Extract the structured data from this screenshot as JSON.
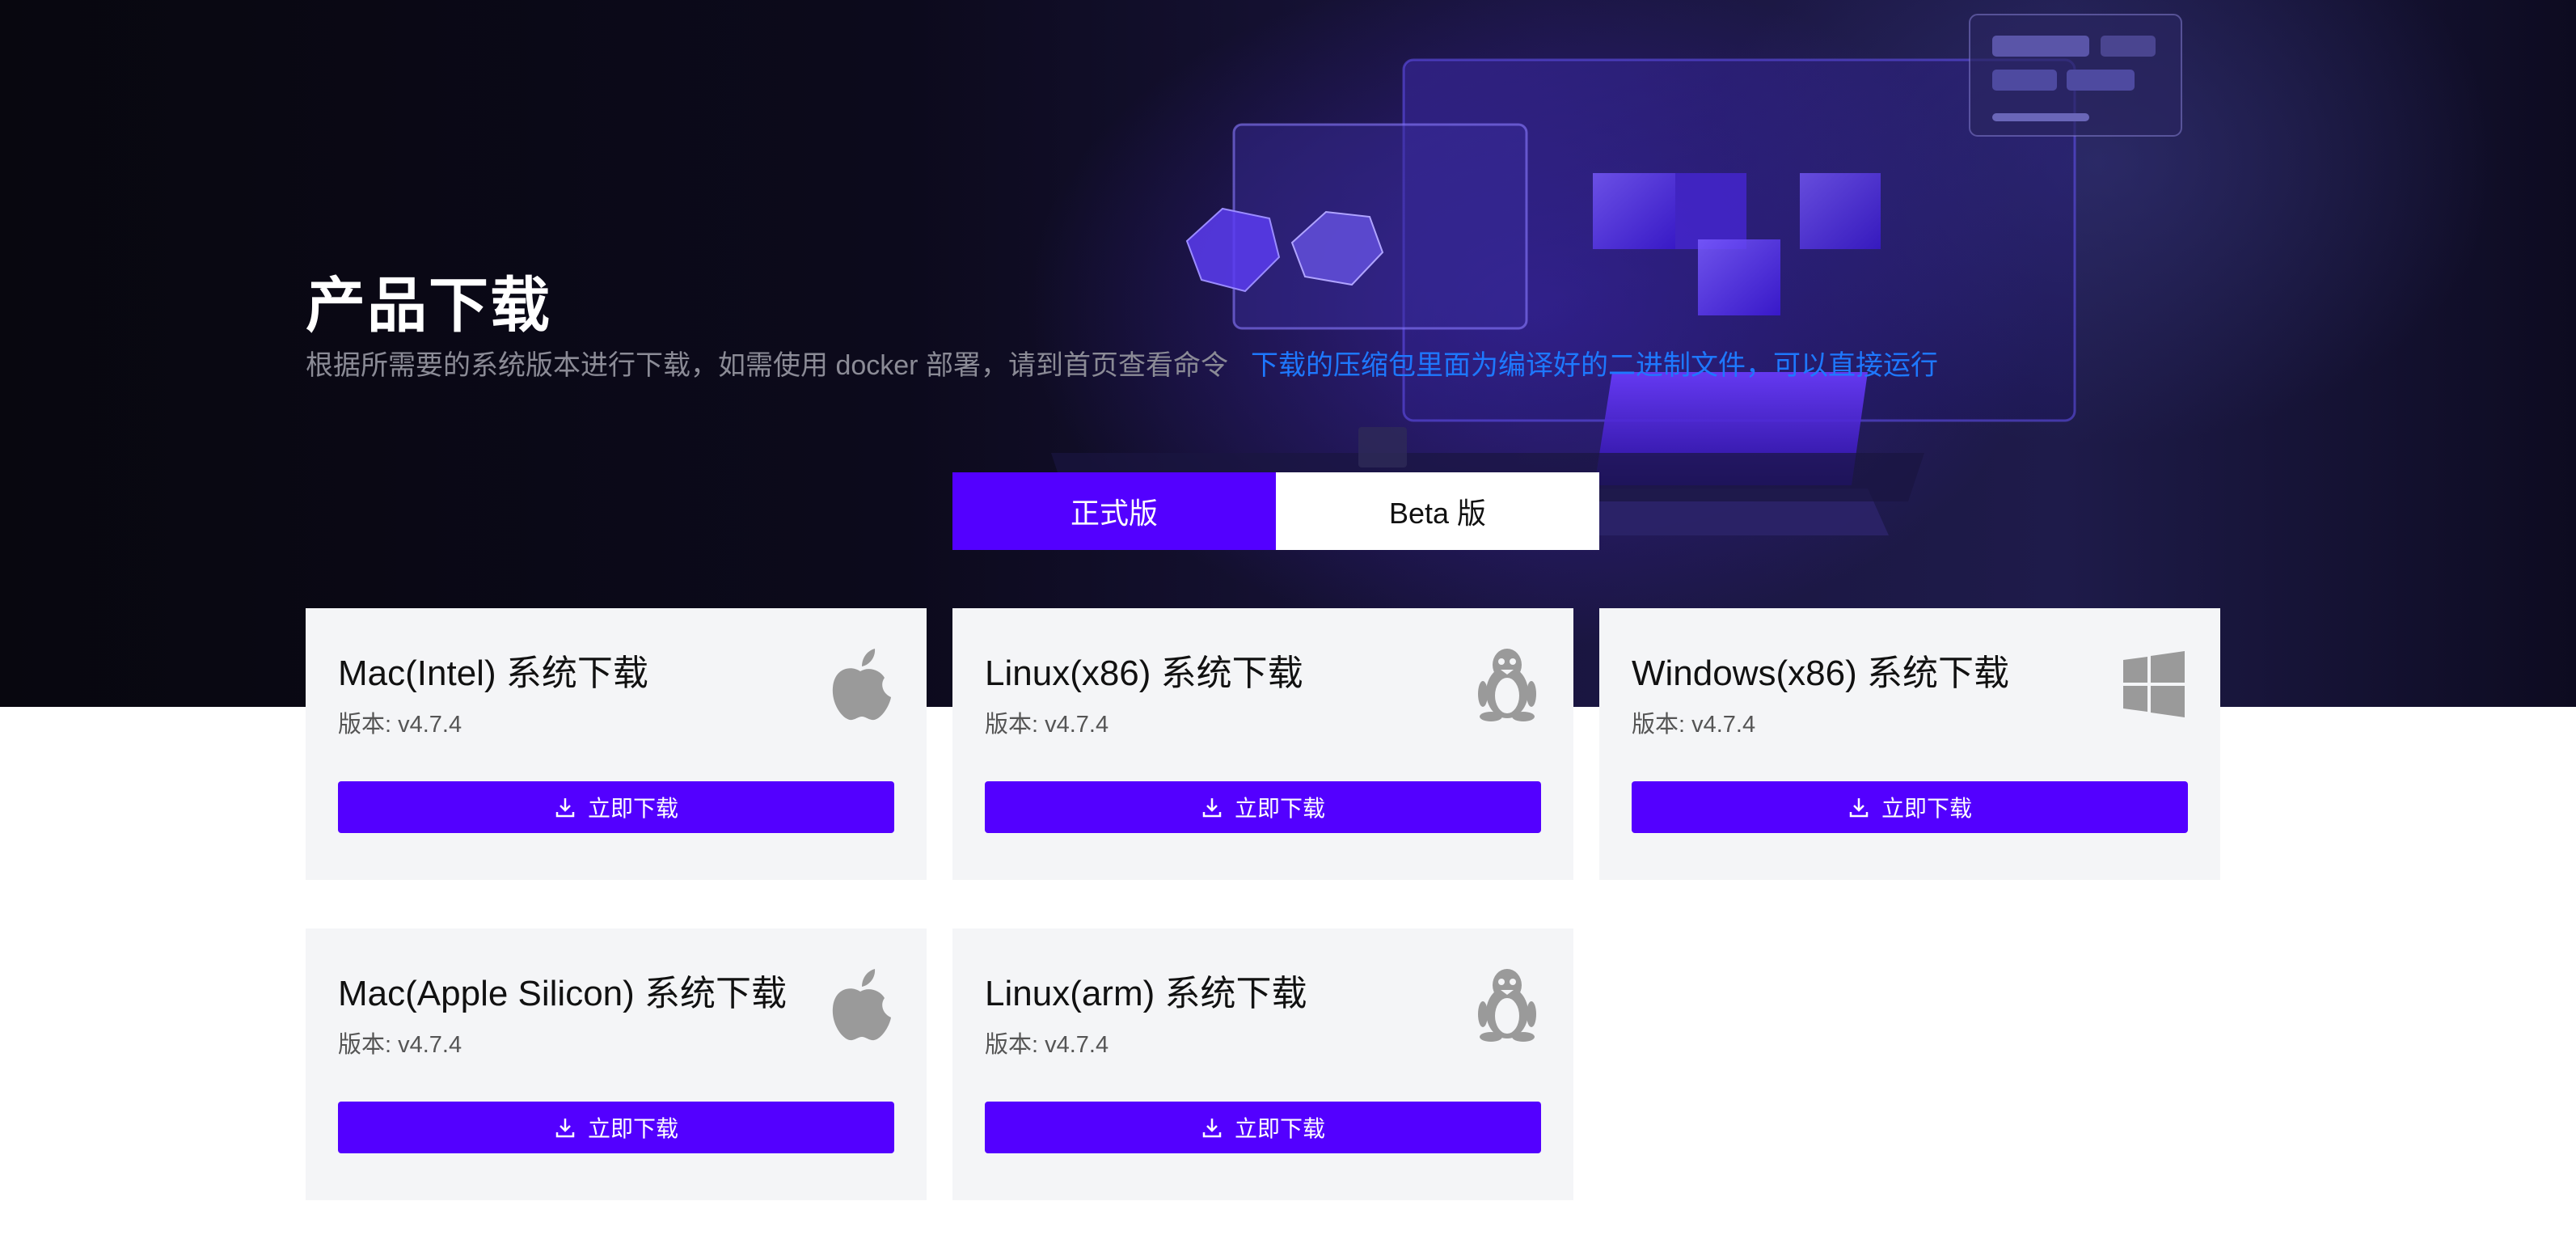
{
  "hero": {
    "title": "产品下载",
    "subtitle_muted": "根据所需要的系统版本进行下载，如需使用 docker 部署，请到首页查看命令",
    "subtitle_highlight": "下载的压缩包里面为编译好的二进制文件，可以直接运行"
  },
  "tabs": [
    {
      "label": "正式版",
      "active": true
    },
    {
      "label": "Beta 版",
      "active": false
    }
  ],
  "download_label": "立即下载",
  "cards": [
    {
      "title": "Mac(Intel) 系统下载",
      "version": "版本: v4.7.4",
      "icon": "apple-icon"
    },
    {
      "title": "Linux(x86) 系统下载",
      "version": "版本: v4.7.4",
      "icon": "linux-icon"
    },
    {
      "title": "Windows(x86) 系统下载",
      "version": "版本: v4.7.4",
      "icon": "windows-icon"
    },
    {
      "title": "Mac(Apple Silicon) 系统下载",
      "version": "版本: v4.7.4",
      "icon": "apple-icon"
    },
    {
      "title": "Linux(arm) 系统下载",
      "version": "版本: v4.7.4",
      "icon": "linux-icon"
    }
  ],
  "colors": {
    "accent": "#5300ff",
    "link": "#1e78ff",
    "card_bg": "#f4f5f7",
    "icon_gray": "#9a9a9a"
  }
}
